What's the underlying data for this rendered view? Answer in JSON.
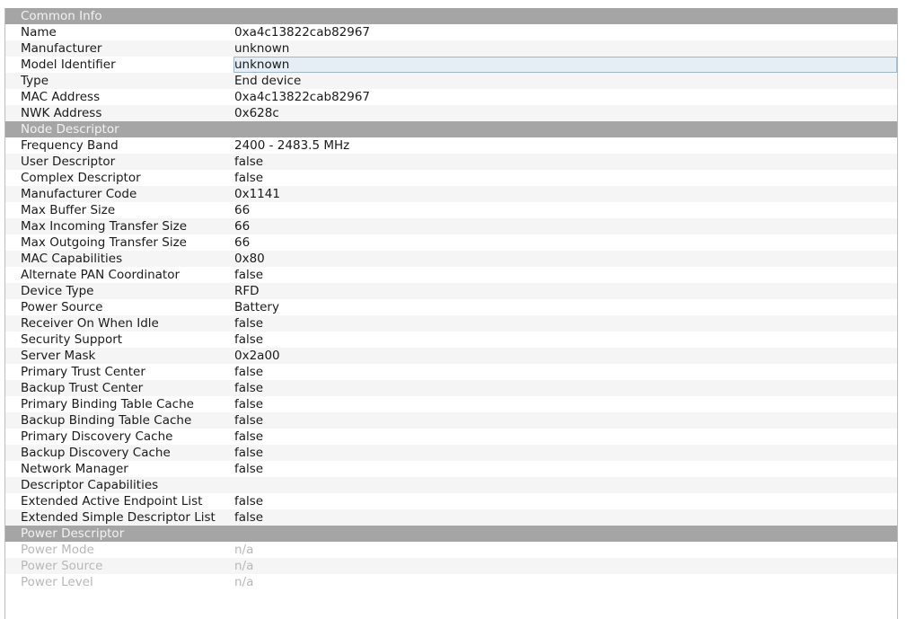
{
  "sections": [
    {
      "title": "Common Info",
      "disabled": false,
      "rows": [
        {
          "label": "Name",
          "value": "0xa4c13822cab82967"
        },
        {
          "label": "Manufacturer",
          "value": "unknown"
        },
        {
          "label": "Model Identifier",
          "value": "unknown",
          "selected": true
        },
        {
          "label": "Type",
          "value": "End device"
        },
        {
          "label": "MAC Address",
          "value": "0xa4c13822cab82967"
        },
        {
          "label": "NWK Address",
          "value": "0x628c"
        }
      ]
    },
    {
      "title": "Node Descriptor",
      "disabled": false,
      "rows": [
        {
          "label": "Frequency Band",
          "value": "2400 - 2483.5 MHz"
        },
        {
          "label": "User Descriptor",
          "value": "false"
        },
        {
          "label": "Complex Descriptor",
          "value": "false"
        },
        {
          "label": "Manufacturer Code",
          "value": "0x1141"
        },
        {
          "label": "Max Buffer Size",
          "value": "66"
        },
        {
          "label": "Max Incoming Transfer Size",
          "value": "66"
        },
        {
          "label": "Max Outgoing Transfer Size",
          "value": "66"
        },
        {
          "label": "MAC Capabilities",
          "value": "0x80"
        },
        {
          "label": "Alternate PAN Coordinator",
          "value": "false"
        },
        {
          "label": "Device Type",
          "value": "RFD"
        },
        {
          "label": "Power Source",
          "value": "Battery"
        },
        {
          "label": "Receiver On When Idle",
          "value": "false"
        },
        {
          "label": "Security Support",
          "value": "false"
        },
        {
          "label": "Server Mask",
          "value": "0x2a00"
        },
        {
          "label": "Primary Trust Center",
          "value": "false"
        },
        {
          "label": "Backup Trust Center",
          "value": "false"
        },
        {
          "label": "Primary Binding Table Cache",
          "value": "false"
        },
        {
          "label": "Backup Binding Table Cache",
          "value": "false"
        },
        {
          "label": "Primary Discovery Cache",
          "value": "false"
        },
        {
          "label": "Backup Discovery Cache",
          "value": "false"
        },
        {
          "label": "Network Manager",
          "value": "false"
        },
        {
          "label": "Descriptor Capabilities",
          "value": ""
        },
        {
          "label": "Extended Active Endpoint List",
          "value": "false"
        },
        {
          "label": "Extended Simple Descriptor List",
          "value": "false"
        }
      ]
    },
    {
      "title": "Power Descriptor",
      "disabled": true,
      "rows": [
        {
          "label": "Power Mode",
          "value": "n/a"
        },
        {
          "label": "Power Source",
          "value": "n/a"
        },
        {
          "label": "Power Level",
          "value": "n/a"
        }
      ]
    }
  ]
}
